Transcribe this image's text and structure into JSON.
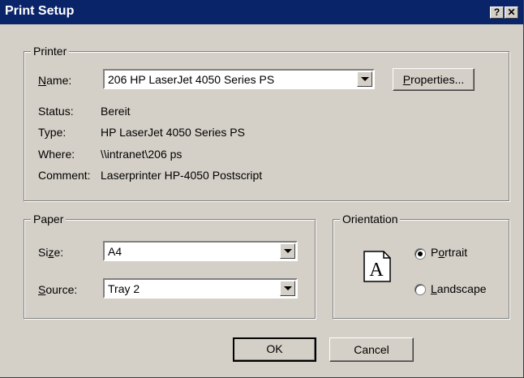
{
  "window": {
    "title": "Print Setup",
    "help_btn": "?",
    "close_btn": "✕"
  },
  "printer": {
    "group_label": "Printer",
    "name": {
      "label_prefix": "",
      "label_u": "N",
      "label_rest": "ame:",
      "value": "206 HP LaserJet 4050 Series PS"
    },
    "properties_button": {
      "u": "P",
      "rest": "roperties..."
    },
    "status": {
      "label": "Status:",
      "value": "Bereit"
    },
    "type": {
      "label": "Type:",
      "value": "HP LaserJet 4050 Series PS"
    },
    "where": {
      "label": "Where:",
      "value": "\\\\intranet\\206 ps"
    },
    "comment": {
      "label": "Comment:",
      "value": "Laserprinter HP-4050 Postscript"
    }
  },
  "paper": {
    "group_label": "Paper",
    "size": {
      "pre": "Si",
      "u": "z",
      "post": "e:",
      "value": "A4"
    },
    "source": {
      "pre": "",
      "u": "S",
      "post": "ource:",
      "value": "Tray 2"
    }
  },
  "orientation": {
    "group_label": "Orientation",
    "icon_letter": "A",
    "portrait": {
      "pre": "P",
      "u": "o",
      "post": "rtrait",
      "checked": true
    },
    "landscape": {
      "pre": "",
      "u": "L",
      "post": "andscape",
      "checked": false
    }
  },
  "buttons": {
    "ok": "OK",
    "cancel": "Cancel"
  },
  "icons": {
    "dropdown": "chevron-down-icon",
    "page": "portrait-page-icon"
  }
}
